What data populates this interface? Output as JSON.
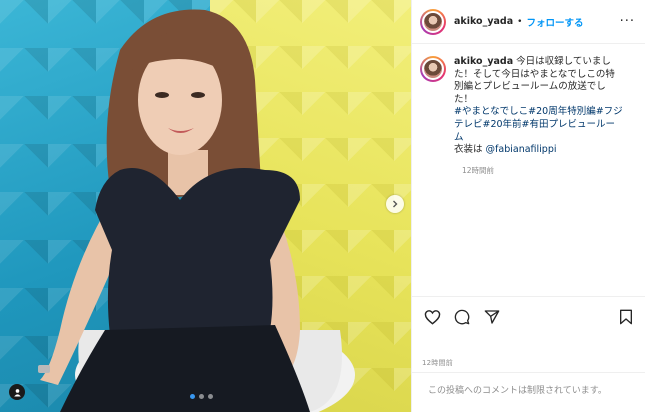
{
  "post": {
    "username": "akiko_yada",
    "separator": "•",
    "follow_label": "フォローする",
    "more_label": "···",
    "caption": {
      "username": "akiko_yada",
      "line1": "今日は収録していまし",
      "line2": "た！そして今日はやまとなでしこの特",
      "line3": "別編とプレビュールームの放送でし",
      "line4": "た！",
      "tags1": "#やまとなでしこ#20周年特別編#フジ",
      "tags2": "テレビ#20年前#有田プレビュールー",
      "tags3": "ム",
      "costume_label": "衣装は ",
      "costume_tag": "@fabianafilippi"
    },
    "caption_time": "12時間前",
    "post_time": "12時間前",
    "comments_disabled": "この投稿へのコメントは制限されています。"
  },
  "icons": {
    "like": "heart-icon",
    "comment": "comment-icon",
    "share": "paper-plane-icon",
    "save": "bookmark-icon",
    "next": "chevron-right-icon",
    "tag": "user-tag-icon"
  },
  "colors": {
    "link_blue": "#0095f6",
    "hashtag": "#00376b",
    "muted": "#8e8e8e",
    "carousel_active": "#3897f0"
  },
  "carousel": {
    "total": 3,
    "active": 1
  }
}
